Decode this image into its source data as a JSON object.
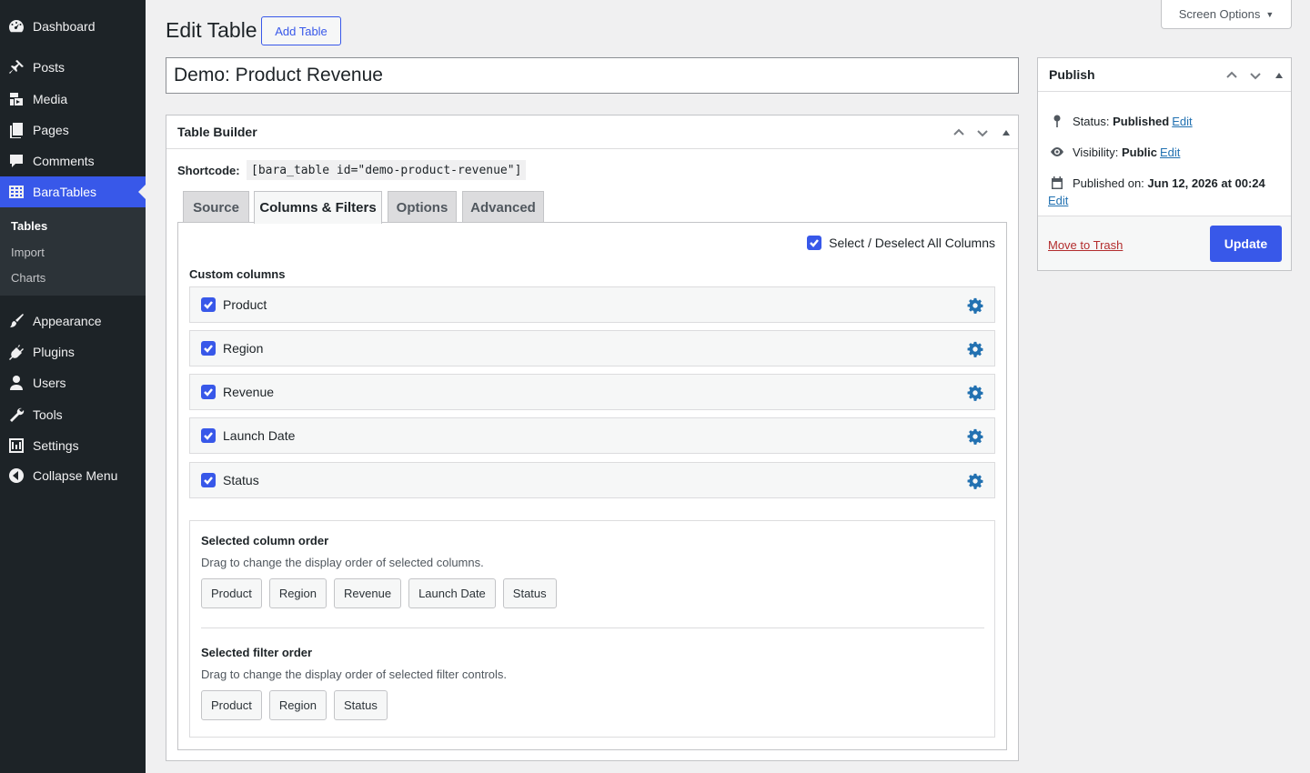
{
  "sidebar": {
    "items": [
      {
        "label": "Dashboard",
        "icon": "dashboard-icon"
      },
      {
        "label": "Posts",
        "icon": "pushpin-icon"
      },
      {
        "label": "Media",
        "icon": "media-icon"
      },
      {
        "label": "Pages",
        "icon": "pages-icon"
      },
      {
        "label": "Comments",
        "icon": "comment-icon"
      },
      {
        "label": "BaraTables",
        "icon": "table-grid-icon"
      },
      {
        "label": "Appearance",
        "icon": "paintbrush-icon"
      },
      {
        "label": "Plugins",
        "icon": "plugin-icon"
      },
      {
        "label": "Users",
        "icon": "user-icon"
      },
      {
        "label": "Tools",
        "icon": "wrench-icon"
      },
      {
        "label": "Settings",
        "icon": "settings-icon"
      },
      {
        "label": "Collapse Menu",
        "icon": "collapse-icon"
      }
    ],
    "submenu": [
      "Tables",
      "Import",
      "Charts"
    ]
  },
  "header": {
    "screen_options": "Screen Options",
    "title": "Edit Table",
    "add_button": "Add Table",
    "table_title": "Demo: Product Revenue"
  },
  "builder": {
    "title": "Table Builder",
    "shortcode_label": "Shortcode:",
    "shortcode": "[bara_table id=\"demo-product-revenue\"]",
    "tabs": [
      "Source",
      "Columns & Filters",
      "Options",
      "Advanced"
    ],
    "active_tab": "Columns & Filters",
    "select_all_label": "Select / Deselect All Columns",
    "custom_columns_title": "Custom columns",
    "columns": [
      "Product",
      "Region",
      "Revenue",
      "Launch Date",
      "Status"
    ],
    "column_order_title": "Selected column order",
    "column_order_desc": "Drag to change the display order of selected columns.",
    "column_order": [
      "Product",
      "Region",
      "Revenue",
      "Launch Date",
      "Status"
    ],
    "filter_order_title": "Selected filter order",
    "filter_order_desc": "Drag to change the display order of selected filter controls.",
    "filter_order": [
      "Product",
      "Region",
      "Status"
    ]
  },
  "publish": {
    "title": "Publish",
    "status_label": "Status:",
    "status_value": "Published",
    "visibility_label": "Visibility:",
    "visibility_value": "Public",
    "published_label": "Published on:",
    "published_value": "Jun 12, 2026 at 00:24",
    "edit_label": "Edit",
    "trash_label": "Move to Trash",
    "update_label": "Update"
  },
  "colors": {
    "accent": "#3858e9",
    "sidebar_bg": "#1d2327",
    "link": "#2271b1",
    "trash": "#b32d2e"
  }
}
